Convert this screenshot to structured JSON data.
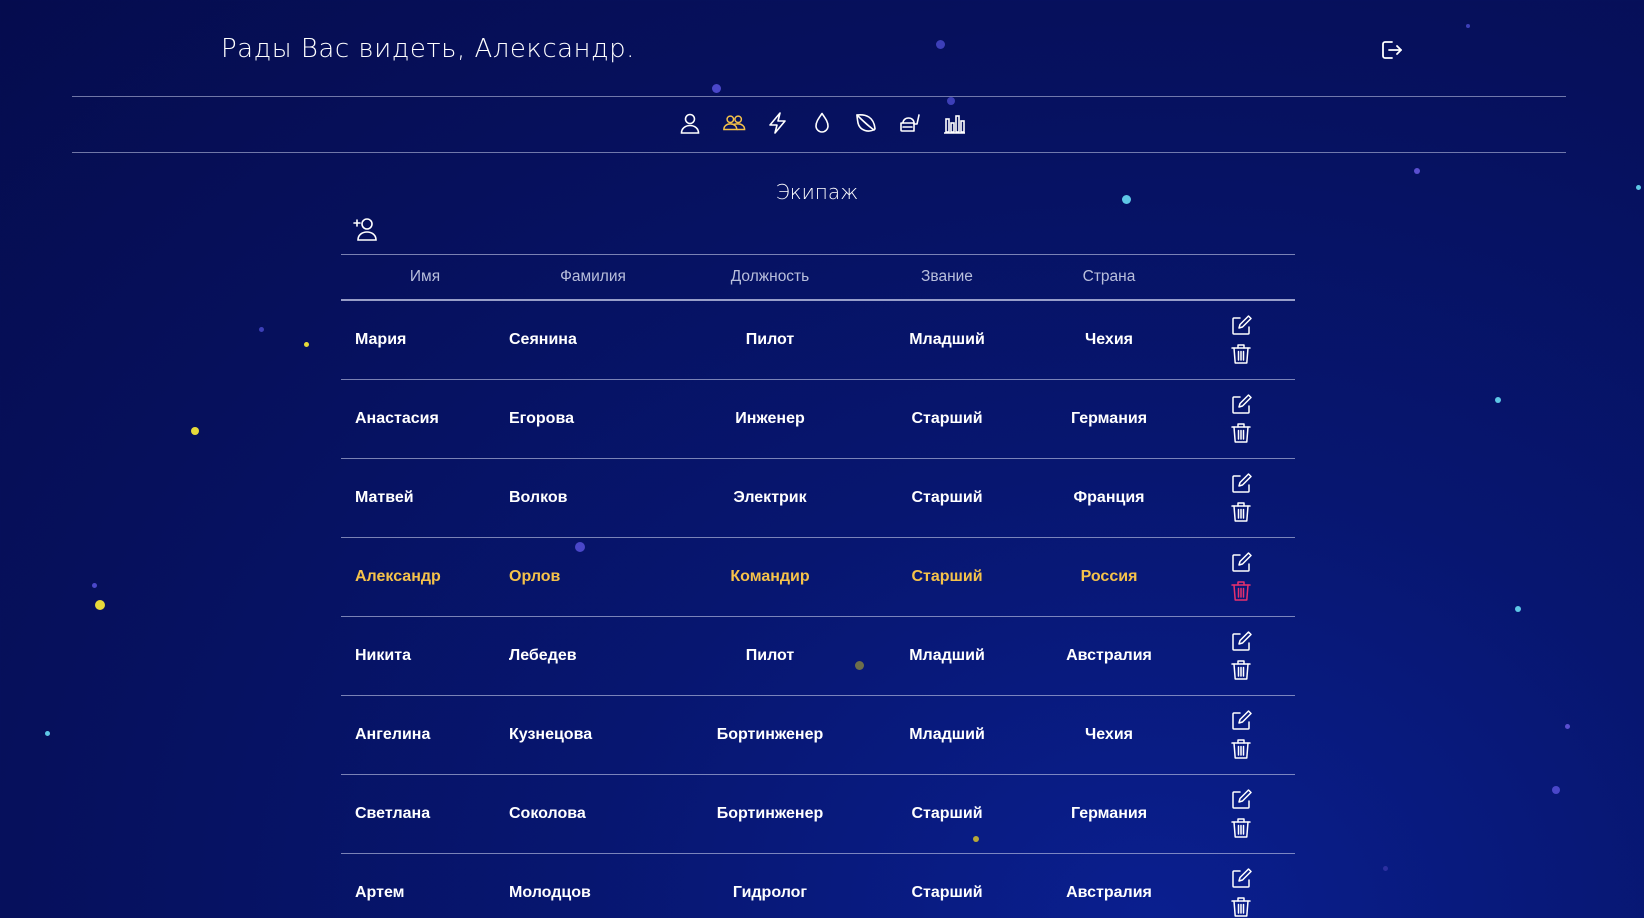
{
  "header": {
    "greeting": "Рады Вас видеть, Александр.",
    "logout_icon": "logout-icon"
  },
  "nav": {
    "items": [
      {
        "icon": "user-icon",
        "active": false
      },
      {
        "icon": "crew-icon",
        "active": true
      },
      {
        "icon": "lightning-icon",
        "active": false
      },
      {
        "icon": "water-drop-icon",
        "active": false
      },
      {
        "icon": "leaf-icon",
        "active": false
      },
      {
        "icon": "food-icon",
        "active": false
      },
      {
        "icon": "bar-chart-icon",
        "active": false
      }
    ]
  },
  "section": {
    "title": "Экипаж",
    "add_icon": "add-user-icon"
  },
  "table": {
    "columns": [
      "Имя",
      "Фамилия",
      "Должность",
      "Звание",
      "Страна"
    ],
    "rows": [
      {
        "name": "Мария",
        "surname": "Сеянина",
        "role": "Пилот",
        "rank": "Младший",
        "country": "Чехия",
        "active": false
      },
      {
        "name": "Анастасия",
        "surname": "Егорова",
        "role": "Инженер",
        "rank": "Старший",
        "country": "Германия",
        "active": false
      },
      {
        "name": "Матвей",
        "surname": "Волков",
        "role": "Электрик",
        "rank": "Старший",
        "country": "Франция",
        "active": false
      },
      {
        "name": "Александр",
        "surname": "Орлов",
        "role": "Командир",
        "rank": "Старший",
        "country": "Россия",
        "active": true
      },
      {
        "name": "Никита",
        "surname": "Лебедев",
        "role": "Пилот",
        "rank": "Младший",
        "country": "Австралия",
        "active": false
      },
      {
        "name": "Ангелина",
        "surname": "Кузнецова",
        "role": "Бортинженер",
        "rank": "Младший",
        "country": "Чехия",
        "active": false
      },
      {
        "name": "Светлана",
        "surname": "Соколова",
        "role": "Бортинженер",
        "rank": "Старший",
        "country": "Германия",
        "active": false
      },
      {
        "name": "Артем",
        "surname": "Молодцов",
        "role": "Гидролог",
        "rank": "Старший",
        "country": "Австралия",
        "active": false
      }
    ]
  },
  "colors": {
    "background": "#06105c",
    "accent": "#f5c24a",
    "delete_active": "#e8306e",
    "text": "#ffffff",
    "header_text": "#b9bfdc"
  }
}
